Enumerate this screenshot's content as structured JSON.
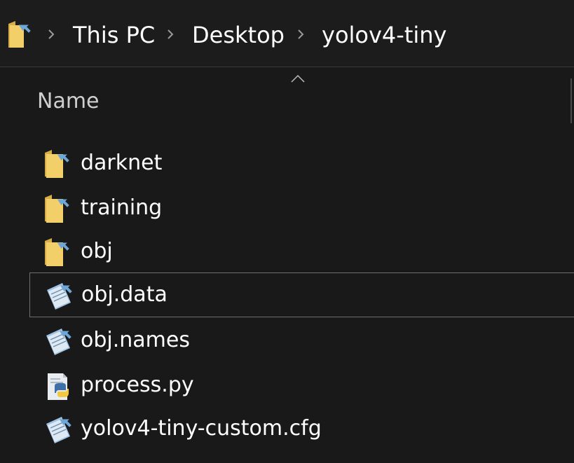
{
  "breadcrumb": [
    "This PC",
    "Desktop",
    "yolov4-tiny"
  ],
  "column_header": "Name",
  "files": [
    {
      "name": "darknet",
      "icon": "folder-shortcut-icon"
    },
    {
      "name": "training",
      "icon": "folder-shortcut-icon"
    },
    {
      "name": "obj",
      "icon": "folder-shortcut-icon"
    },
    {
      "name": "obj.data",
      "icon": "text-file-icon",
      "selected": true
    },
    {
      "name": "obj.names",
      "icon": "text-file-icon"
    },
    {
      "name": "process.py",
      "icon": "python-file-icon"
    },
    {
      "name": "yolov4-tiny-custom.cfg",
      "icon": "text-file-icon"
    }
  ],
  "colors": {
    "background": "#191919",
    "folder": "#f3cf6a",
    "shortcut_arrow": "#6ea6d8",
    "selection_border": "#6f6f6f"
  }
}
